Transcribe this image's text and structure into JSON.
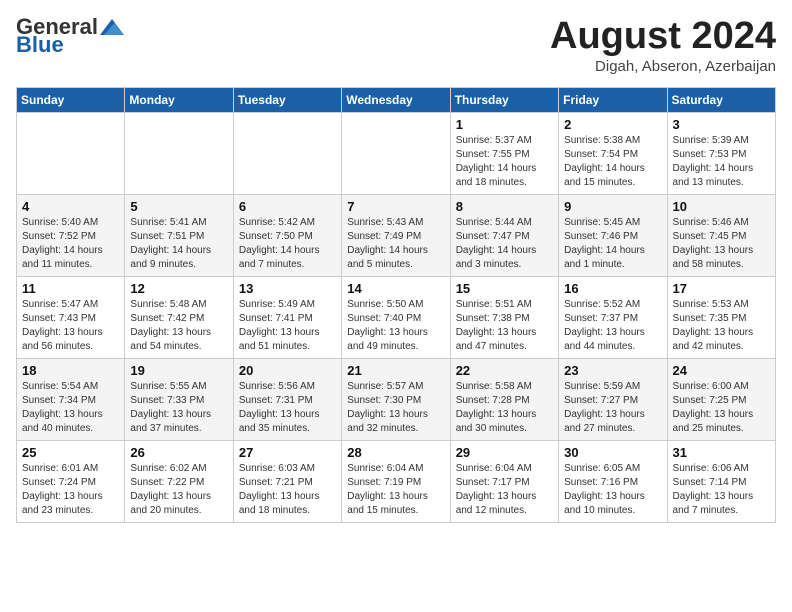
{
  "header": {
    "logo_general": "General",
    "logo_blue": "Blue",
    "month_year": "August 2024",
    "location": "Digah, Abseron, Azerbaijan"
  },
  "days_of_week": [
    "Sunday",
    "Monday",
    "Tuesday",
    "Wednesday",
    "Thursday",
    "Friday",
    "Saturday"
  ],
  "weeks": [
    [
      {
        "day": "",
        "info": ""
      },
      {
        "day": "",
        "info": ""
      },
      {
        "day": "",
        "info": ""
      },
      {
        "day": "",
        "info": ""
      },
      {
        "day": "1",
        "info": "Sunrise: 5:37 AM\nSunset: 7:55 PM\nDaylight: 14 hours\nand 18 minutes."
      },
      {
        "day": "2",
        "info": "Sunrise: 5:38 AM\nSunset: 7:54 PM\nDaylight: 14 hours\nand 15 minutes."
      },
      {
        "day": "3",
        "info": "Sunrise: 5:39 AM\nSunset: 7:53 PM\nDaylight: 14 hours\nand 13 minutes."
      }
    ],
    [
      {
        "day": "4",
        "info": "Sunrise: 5:40 AM\nSunset: 7:52 PM\nDaylight: 14 hours\nand 11 minutes."
      },
      {
        "day": "5",
        "info": "Sunrise: 5:41 AM\nSunset: 7:51 PM\nDaylight: 14 hours\nand 9 minutes."
      },
      {
        "day": "6",
        "info": "Sunrise: 5:42 AM\nSunset: 7:50 PM\nDaylight: 14 hours\nand 7 minutes."
      },
      {
        "day": "7",
        "info": "Sunrise: 5:43 AM\nSunset: 7:49 PM\nDaylight: 14 hours\nand 5 minutes."
      },
      {
        "day": "8",
        "info": "Sunrise: 5:44 AM\nSunset: 7:47 PM\nDaylight: 14 hours\nand 3 minutes."
      },
      {
        "day": "9",
        "info": "Sunrise: 5:45 AM\nSunset: 7:46 PM\nDaylight: 14 hours\nand 1 minute."
      },
      {
        "day": "10",
        "info": "Sunrise: 5:46 AM\nSunset: 7:45 PM\nDaylight: 13 hours\nand 58 minutes."
      }
    ],
    [
      {
        "day": "11",
        "info": "Sunrise: 5:47 AM\nSunset: 7:43 PM\nDaylight: 13 hours\nand 56 minutes."
      },
      {
        "day": "12",
        "info": "Sunrise: 5:48 AM\nSunset: 7:42 PM\nDaylight: 13 hours\nand 54 minutes."
      },
      {
        "day": "13",
        "info": "Sunrise: 5:49 AM\nSunset: 7:41 PM\nDaylight: 13 hours\nand 51 minutes."
      },
      {
        "day": "14",
        "info": "Sunrise: 5:50 AM\nSunset: 7:40 PM\nDaylight: 13 hours\nand 49 minutes."
      },
      {
        "day": "15",
        "info": "Sunrise: 5:51 AM\nSunset: 7:38 PM\nDaylight: 13 hours\nand 47 minutes."
      },
      {
        "day": "16",
        "info": "Sunrise: 5:52 AM\nSunset: 7:37 PM\nDaylight: 13 hours\nand 44 minutes."
      },
      {
        "day": "17",
        "info": "Sunrise: 5:53 AM\nSunset: 7:35 PM\nDaylight: 13 hours\nand 42 minutes."
      }
    ],
    [
      {
        "day": "18",
        "info": "Sunrise: 5:54 AM\nSunset: 7:34 PM\nDaylight: 13 hours\nand 40 minutes."
      },
      {
        "day": "19",
        "info": "Sunrise: 5:55 AM\nSunset: 7:33 PM\nDaylight: 13 hours\nand 37 minutes."
      },
      {
        "day": "20",
        "info": "Sunrise: 5:56 AM\nSunset: 7:31 PM\nDaylight: 13 hours\nand 35 minutes."
      },
      {
        "day": "21",
        "info": "Sunrise: 5:57 AM\nSunset: 7:30 PM\nDaylight: 13 hours\nand 32 minutes."
      },
      {
        "day": "22",
        "info": "Sunrise: 5:58 AM\nSunset: 7:28 PM\nDaylight: 13 hours\nand 30 minutes."
      },
      {
        "day": "23",
        "info": "Sunrise: 5:59 AM\nSunset: 7:27 PM\nDaylight: 13 hours\nand 27 minutes."
      },
      {
        "day": "24",
        "info": "Sunrise: 6:00 AM\nSunset: 7:25 PM\nDaylight: 13 hours\nand 25 minutes."
      }
    ],
    [
      {
        "day": "25",
        "info": "Sunrise: 6:01 AM\nSunset: 7:24 PM\nDaylight: 13 hours\nand 23 minutes."
      },
      {
        "day": "26",
        "info": "Sunrise: 6:02 AM\nSunset: 7:22 PM\nDaylight: 13 hours\nand 20 minutes."
      },
      {
        "day": "27",
        "info": "Sunrise: 6:03 AM\nSunset: 7:21 PM\nDaylight: 13 hours\nand 18 minutes."
      },
      {
        "day": "28",
        "info": "Sunrise: 6:04 AM\nSunset: 7:19 PM\nDaylight: 13 hours\nand 15 minutes."
      },
      {
        "day": "29",
        "info": "Sunrise: 6:04 AM\nSunset: 7:17 PM\nDaylight: 13 hours\nand 12 minutes."
      },
      {
        "day": "30",
        "info": "Sunrise: 6:05 AM\nSunset: 7:16 PM\nDaylight: 13 hours\nand 10 minutes."
      },
      {
        "day": "31",
        "info": "Sunrise: 6:06 AM\nSunset: 7:14 PM\nDaylight: 13 hours\nand 7 minutes."
      }
    ]
  ]
}
